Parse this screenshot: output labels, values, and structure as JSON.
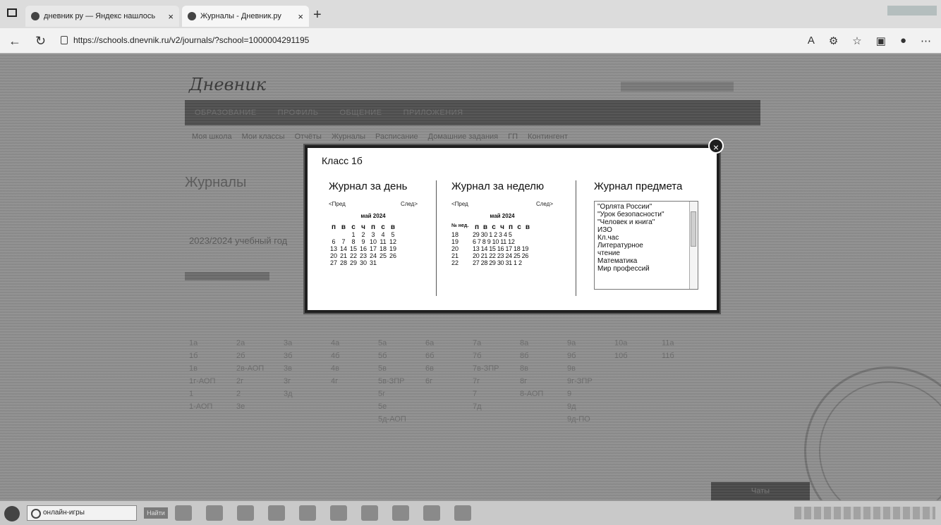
{
  "browser": {
    "tabs": [
      {
        "label": "дневник ру — Яндекс нашлось",
        "active": false
      },
      {
        "label": "Журналы - Дневник.ру",
        "active": true
      }
    ],
    "new_tab": "+",
    "url": "https://schools.dnevnik.ru/v2/journals/?school=1000004291195"
  },
  "site": {
    "logo": "Дневник",
    "nav": [
      "ОБРАЗОВАНИЕ",
      "ПРОФИЛЬ",
      "ОБЩЕНИЕ",
      "ПРИЛОЖЕНИЯ"
    ],
    "subnav": [
      "Моя школа",
      "Мои классы",
      "Отчёты",
      "Журналы",
      "Расписание",
      "Домашние задания",
      "ГП",
      "Контингент"
    ],
    "page_title": "Журналы",
    "year_text": "2023/2024 учебный год",
    "chat_label": "Чаты",
    "class_grid": [
      [
        "1а",
        "2а",
        "3а",
        "4а",
        "5а",
        "6а",
        "7а",
        "8а",
        "9а",
        "10а",
        "11а"
      ],
      [
        "1б",
        "2б",
        "3б",
        "4б",
        "5б",
        "6б",
        "7б",
        "8б",
        "9б",
        "10б",
        "11б"
      ],
      [
        "1в",
        "2в-АОП",
        "3в",
        "4в",
        "5в",
        "6в",
        "7в-ЗПР",
        "8в",
        "9в",
        "",
        ""
      ],
      [
        "1г-АОП",
        "2г",
        "3г",
        "4г",
        "5в-ЗПР",
        "6г",
        "7г",
        "8г",
        "9г-ЗПР",
        "",
        ""
      ],
      [
        "1",
        "2",
        "3д",
        "",
        "5г",
        "",
        "7",
        "8-АОП",
        "9",
        "",
        ""
      ],
      [
        "1-АОП",
        "3е",
        "",
        "",
        "5е",
        "",
        "7д",
        "",
        "9д",
        "",
        ""
      ],
      [
        "",
        "",
        "",
        "",
        "5д-АОП",
        "",
        "",
        "",
        "9д-ПО",
        "",
        ""
      ]
    ]
  },
  "modal": {
    "title": "Класс 1б",
    "close": "×",
    "day": {
      "heading": "Журнал за день",
      "prev": "<Пред",
      "next": "След>",
      "month": "май 2024",
      "weekdays": [
        "п",
        "в",
        "с",
        "ч",
        "п",
        "с",
        "в"
      ],
      "rows": [
        [
          "",
          "",
          "1",
          "2",
          "3",
          "4",
          "5"
        ],
        [
          "6",
          "7",
          "8",
          "9",
          "10",
          "11",
          "12"
        ],
        [
          "13",
          "14",
          "15",
          "16",
          "17",
          "18",
          "19"
        ],
        [
          "20",
          "21",
          "22",
          "23",
          "24",
          "25",
          "26"
        ],
        [
          "27",
          "28",
          "29",
          "30",
          "31",
          "",
          ""
        ]
      ]
    },
    "week": {
      "heading": "Журнал за неделю",
      "prev": "<Пред",
      "next": "След>",
      "month": "май 2024",
      "week_col": "№ нед.",
      "weekdays": [
        "п",
        "в",
        "с",
        "ч",
        "п",
        "с",
        "в"
      ],
      "rows": [
        {
          "wk": "18",
          "days": "29 30 1 2 3 4 5"
        },
        {
          "wk": "19",
          "days": "6 7 8 9 10 11 12"
        },
        {
          "wk": "20",
          "days": "13 14 15 16 17 18 19"
        },
        {
          "wk": "21",
          "days": "20 21 22 23 24 25 26"
        },
        {
          "wk": "22",
          "days": "27 28 29 30 31 1 2"
        }
      ]
    },
    "subject": {
      "heading": "Журнал предмета",
      "items": [
        "\"Орлята России\"",
        "\"Урок безопасности\"",
        "\"Человек и книга\"",
        "ИЗО",
        "Кл.час",
        "Литературное",
        "чтение",
        "Математика",
        "Мир профессий"
      ]
    }
  },
  "taskbar": {
    "search_placeholder": "онлайн-игры",
    "find_label": "Найти"
  }
}
